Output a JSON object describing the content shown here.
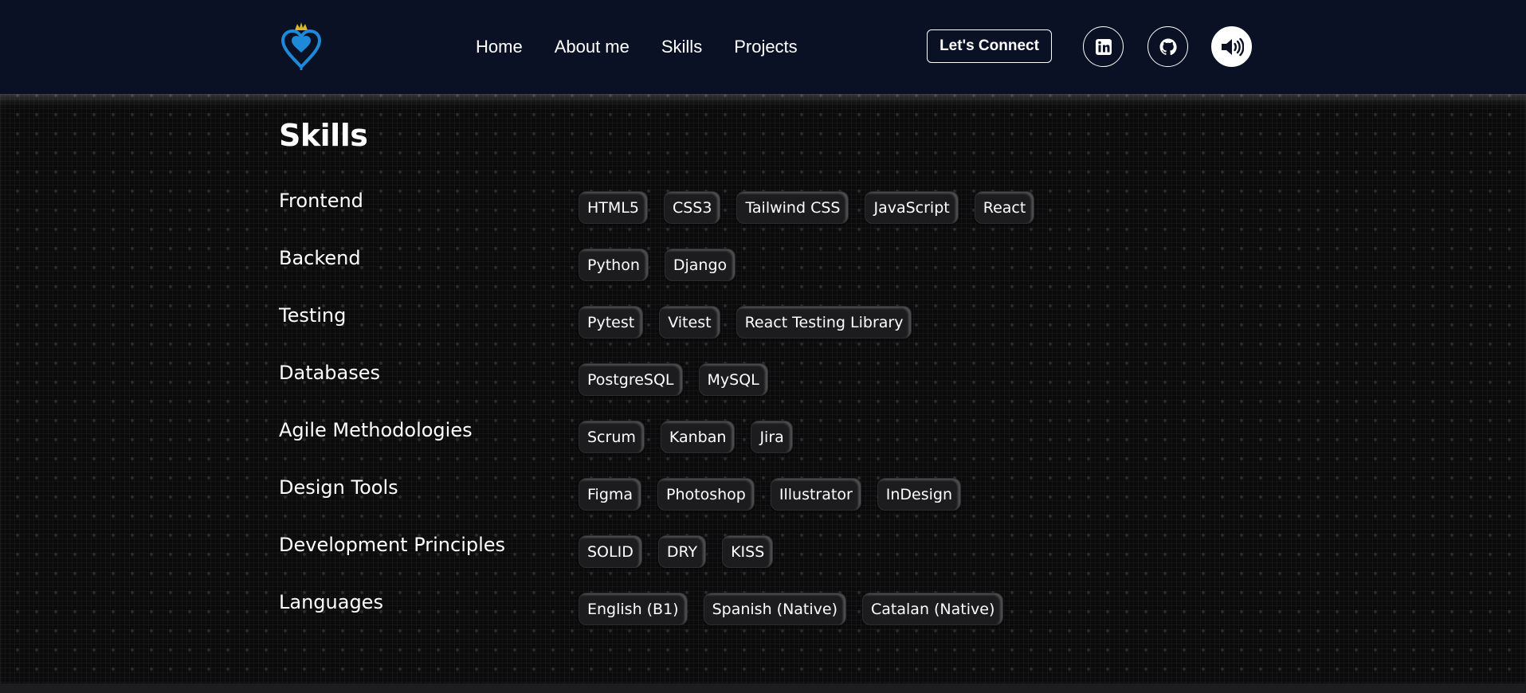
{
  "nav": {
    "logo_icon": "kingdom-hearts-heart-crown-icon",
    "links": [
      "Home",
      "About me",
      "Skills",
      "Projects"
    ],
    "connect_label": "Let's Connect",
    "icons": [
      "linkedin-icon",
      "github-icon",
      "speaker-icon"
    ]
  },
  "skills": {
    "title": "Skills",
    "categories": [
      {
        "label": "Frontend",
        "items": [
          "HTML5",
          "CSS3",
          "Tailwind CSS",
          "JavaScript",
          "React"
        ]
      },
      {
        "label": "Backend",
        "items": [
          "Python",
          "Django"
        ]
      },
      {
        "label": "Testing",
        "items": [
          "Pytest",
          "Vitest",
          "React Testing Library"
        ]
      },
      {
        "label": "Databases",
        "items": [
          "PostgreSQL",
          "MySQL"
        ]
      },
      {
        "label": "Agile Methodologies",
        "items": [
          "Scrum",
          "Kanban",
          "Jira"
        ]
      },
      {
        "label": "Design Tools",
        "items": [
          "Figma",
          "Photoshop",
          "Illustrator",
          "InDesign"
        ]
      },
      {
        "label": "Development Principles",
        "items": [
          "SOLID",
          "DRY",
          "KISS"
        ]
      },
      {
        "label": "Languages",
        "items": [
          "English (B1)",
          "Spanish (Native)",
          "Catalan (Native)"
        ]
      }
    ]
  },
  "colors": {
    "navbar_bg": "#0a1124",
    "logo_heart": "#1e88d9",
    "logo_crown": "#e0b32c",
    "chip_bg": "#1c1c1e"
  }
}
